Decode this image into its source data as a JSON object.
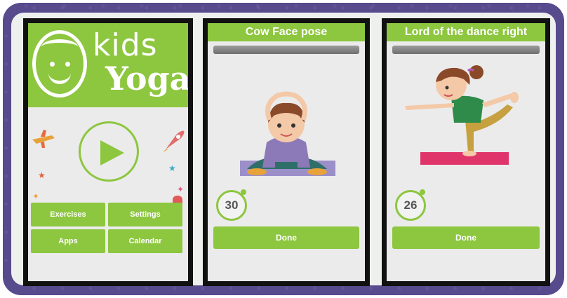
{
  "home_screen": {
    "logo": {
      "word1": "kids",
      "word2": "Yoga"
    },
    "play_icon": "play-icon",
    "buttons": [
      {
        "label": "Exercises"
      },
      {
        "label": "Settings"
      },
      {
        "label": "Apps"
      },
      {
        "label": "Calendar"
      }
    ],
    "accent_color": "#8dc63f"
  },
  "pose_screens": [
    {
      "title": "Cow Face pose",
      "timer": "30",
      "done_label": "Done",
      "progress": 0,
      "illustration": "girl-cow-face-pose"
    },
    {
      "title": "Lord of the dance right",
      "timer": "26",
      "done_label": "Done",
      "progress": 0,
      "illustration": "girl-lord-of-the-dance-pose"
    }
  ],
  "colors": {
    "frame": "#574a8d",
    "accent": "#8dc63f",
    "mat_purple": "#9b8fc9",
    "mat_pink": "#e0356b"
  }
}
